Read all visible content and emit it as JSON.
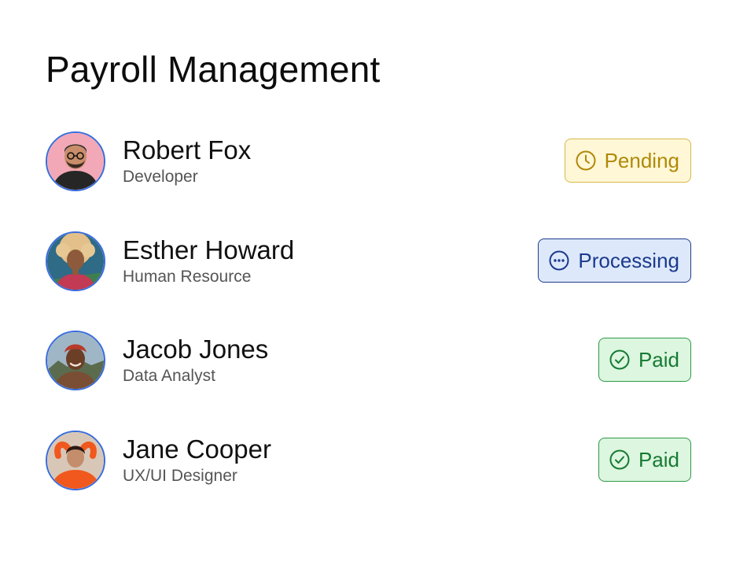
{
  "page": {
    "title": "Payroll Management"
  },
  "employees": [
    {
      "name": "Robert Fox",
      "role": "Developer",
      "status": "Pending",
      "status_icon": "clock-icon"
    },
    {
      "name": "Esther Howard",
      "role": "Human Resource",
      "status": "Processing",
      "status_icon": "ellipsis-circle-icon"
    },
    {
      "name": "Jacob Jones",
      "role": "Data Analyst",
      "status": "Paid",
      "status_icon": "check-circle-icon"
    },
    {
      "name": "Jane Cooper",
      "role": "UX/UI Designer",
      "status": "Paid",
      "status_icon": "check-circle-icon"
    }
  ],
  "colors": {
    "avatar_border": "#3a6ddc",
    "pending_bg": "#fff7d6",
    "pending_fg": "#b08908",
    "processing_bg": "#dde8fb",
    "processing_fg": "#1b3a8c",
    "paid_bg": "#dcf6df",
    "paid_fg": "#177a33"
  }
}
